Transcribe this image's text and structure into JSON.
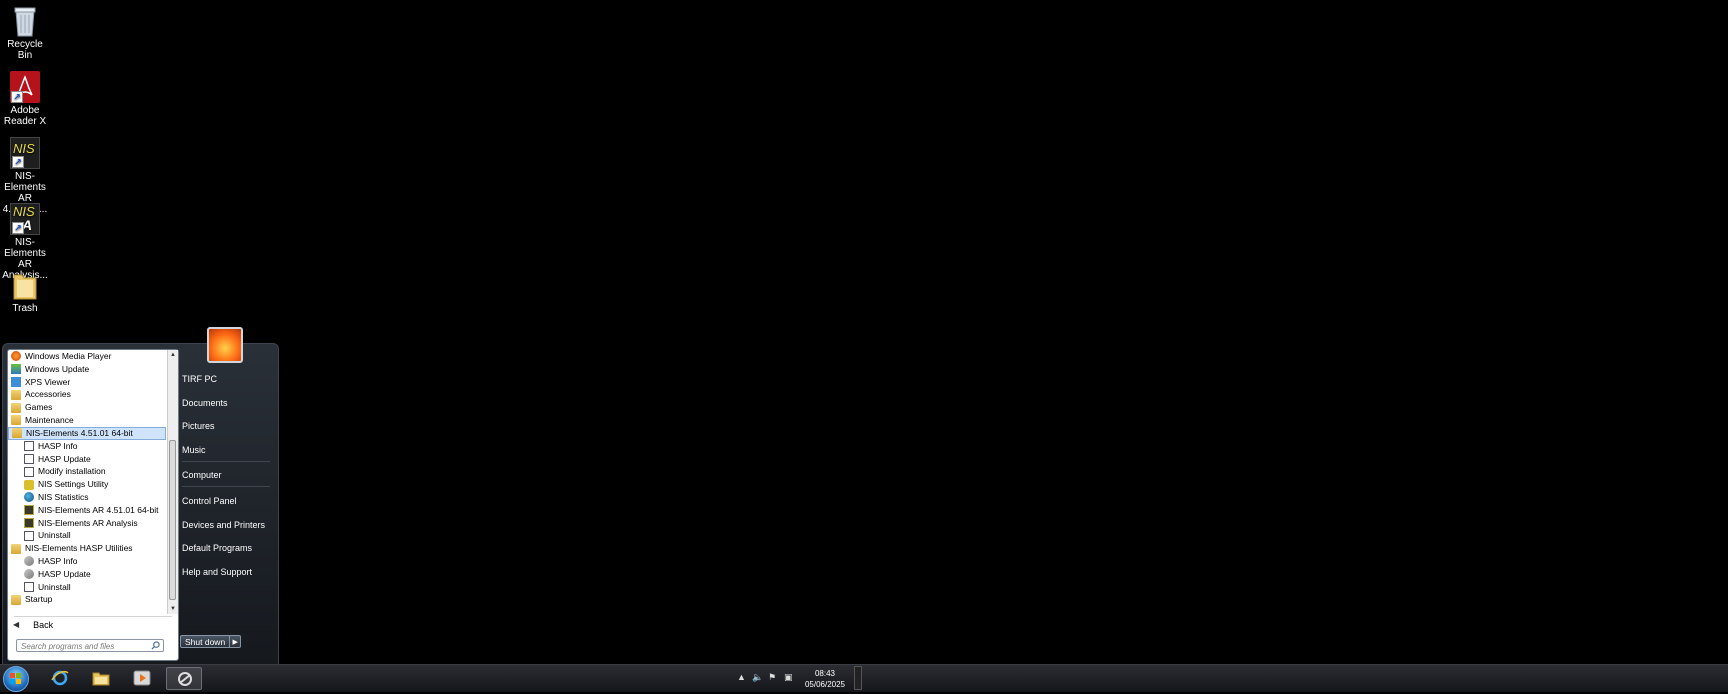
{
  "desktop": {
    "icons": [
      {
        "label": "Recycle Bin"
      },
      {
        "label": "Adobe Reader X"
      },
      {
        "label": "NIS-Elements AR 4.51.01 ..."
      },
      {
        "label": "NIS-Elements AR Analysis..."
      },
      {
        "label": "Trash"
      }
    ],
    "nis_icon_text": "NIS"
  },
  "start_menu": {
    "programs": [
      {
        "label": "Windows Media Player",
        "icon": "media-player-icon",
        "indent": false
      },
      {
        "label": "Windows Update",
        "icon": "windows-update-icon",
        "indent": false
      },
      {
        "label": "XPS Viewer",
        "icon": "xps-viewer-icon",
        "indent": false
      },
      {
        "label": "Accessories",
        "icon": "folder-icon",
        "indent": false
      },
      {
        "label": "Games",
        "icon": "folder-icon",
        "indent": false
      },
      {
        "label": "Maintenance",
        "icon": "folder-icon",
        "indent": false
      },
      {
        "label": "NIS-Elements 4.51.01 64-bit",
        "icon": "folder-icon",
        "indent": false,
        "selected": true
      },
      {
        "label": "HASP Info",
        "icon": "app-icon",
        "indent": true
      },
      {
        "label": "HASP Update",
        "icon": "app-icon",
        "indent": true
      },
      {
        "label": "Modify installation",
        "icon": "app-icon",
        "indent": true
      },
      {
        "label": "NIS Settings Utility",
        "icon": "gear-icon",
        "indent": true
      },
      {
        "label": "NIS Statistics",
        "icon": "globe-icon",
        "indent": true
      },
      {
        "label": "NIS-Elements AR 4.51.01 64-bit",
        "icon": "nis-icon",
        "indent": true
      },
      {
        "label": "NIS-Elements AR Analysis",
        "icon": "nis-icon",
        "indent": true
      },
      {
        "label": "Uninstall",
        "icon": "app-icon",
        "indent": true
      },
      {
        "label": "NIS-Elements HASP Utilities",
        "icon": "folder-icon",
        "indent": false
      },
      {
        "label": "HASP Info",
        "icon": "key-icon",
        "indent": true
      },
      {
        "label": "HASP Update",
        "icon": "key-icon",
        "indent": true
      },
      {
        "label": "Uninstall",
        "icon": "app-icon",
        "indent": true
      },
      {
        "label": "Startup",
        "icon": "folder-icon",
        "indent": false
      }
    ],
    "back_label": "Back",
    "search_placeholder": "Search programs and files",
    "right_items": [
      {
        "label": "TIRF PC"
      },
      {
        "label": "Documents"
      },
      {
        "label": "Pictures"
      },
      {
        "label": "Music"
      },
      {
        "label": "Computer"
      },
      {
        "label": "Control Panel"
      },
      {
        "label": "Devices and Printers"
      },
      {
        "label": "Default Programs"
      },
      {
        "label": "Help and Support"
      }
    ],
    "shutdown_label": "Shut down"
  },
  "taskbar": {
    "pinned": [
      "internet-explorer-icon",
      "file-explorer-icon",
      "media-player-icon",
      "active-app-icon"
    ],
    "time": "08:43",
    "date": "05/06/2025"
  }
}
